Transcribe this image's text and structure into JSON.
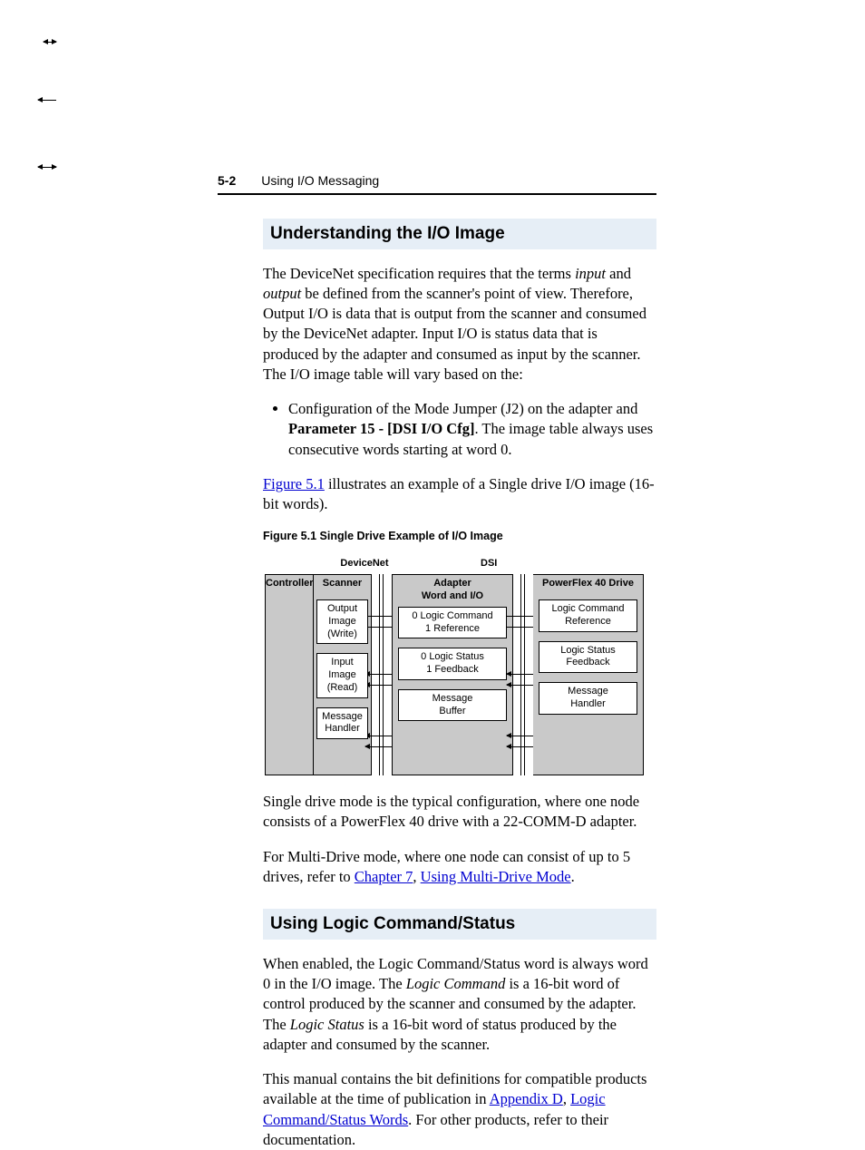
{
  "header": {
    "page_num": "5-2",
    "section": "Using I/O Messaging"
  },
  "s1": {
    "title": "Understanding the I/O Image",
    "p1a": "The DeviceNet specification requires that the terms ",
    "p1_i1": "input",
    "p1b": " and ",
    "p1_i2": "output",
    "p1c": " be defined from the scanner's point of view. Therefore, Output I/O is data that is output from the scanner and consumed by the DeviceNet adapter. Input I/O is status data that is produced by the adapter and consumed as input by the scanner. The I/O image table will vary based on the:",
    "b1a": "Configuration of the Mode Jumper (J2) on the adapter and ",
    "b1_bold": "Parameter 15 - [DSI I/O Cfg]",
    "b1b": ". The image table always uses consecutive words starting at word 0.",
    "p2_link": "Figure 5.1",
    "p2_rest": " illustrates an example of a Single drive I/O image (16-bit words).",
    "fig_caption": "Figure 5.1   Single Drive Example of I/O Image",
    "p3": "Single drive mode is the typical configuration, where one node consists of a PowerFlex 40 drive with a 22-COMM-D adapter.",
    "p4a": "For Multi-Drive mode, where one node can consist of up to 5 drives, refer to ",
    "p4_link1": "Chapter 7",
    "p4_mid": ", ",
    "p4_link2": "Using Multi-Drive Mode",
    "p4b": "."
  },
  "diagram": {
    "net_heads": {
      "devicenet": "DeviceNet",
      "dsi": "DSI"
    },
    "controller": "Controller",
    "scanner": {
      "title": "Scanner",
      "out": "Output\nImage\n(Write)",
      "in": "Input\nImage\n(Read)",
      "msg": "Message\nHandler"
    },
    "adapter": {
      "title": "Adapter\nWord and I/O",
      "out": "0 Logic Command\n1 Reference",
      "in": "0 Logic Status\n1 Feedback",
      "msg": "Message\nBuffer"
    },
    "drive": {
      "title": "PowerFlex 40 Drive",
      "out": "Logic Command\nReference",
      "in": "Logic Status\nFeedback",
      "msg": "Message\nHandler"
    }
  },
  "s2": {
    "title": "Using Logic Command/Status",
    "p1a": "When enabled, the Logic Command/Status word is always word 0 in the I/O image. The ",
    "p1_i1": "Logic Command",
    "p1b": " is a 16-bit word of control produced by the scanner and consumed by the adapter. The ",
    "p1_i2": "Logic Status",
    "p1c": " is a 16-bit word of status produced by the adapter and consumed by the scanner.",
    "p2a": "This manual contains the bit definitions for compatible products available at the time of publication in ",
    "p2_link1": "Appendix D",
    "p2_mid": ", ",
    "p2_link2": "Logic Command/Status Words",
    "p2b": ". For other products, refer to their documentation."
  }
}
